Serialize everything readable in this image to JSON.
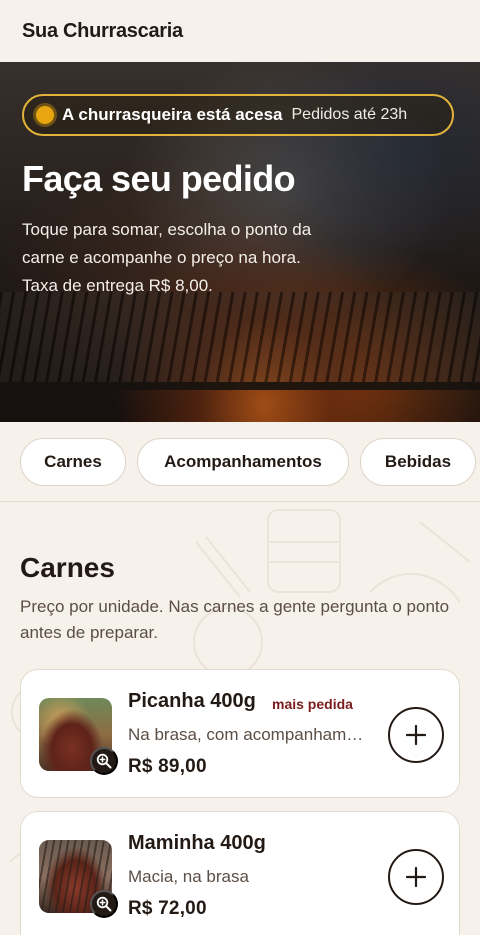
{
  "header": {
    "brand": "Sua Churrascaria"
  },
  "hero": {
    "status_main": "A churrasqueira está acesa",
    "status_sub": "Pedidos até 23h",
    "title": "Faça seu pedido",
    "description": "Toque para somar, escolha o ponto da carne e acompanhe o preço na hora. Taxa de entrega R$ 8,00."
  },
  "tabs": [
    {
      "label": "Carnes"
    },
    {
      "label": "Acompanhamentos"
    },
    {
      "label": "Bebidas"
    }
  ],
  "section": {
    "title": "Carnes",
    "description": "Preço por unidade. Nas carnes a gente pergunta o ponto antes de preparar."
  },
  "items": [
    {
      "name": "Picanha 400g",
      "badge": "mais pedida",
      "description": "Na brasa, com acompanhamentos",
      "price": "R$ 89,00",
      "icon": "zoom-in-icon",
      "add_icon": "plus-icon"
    },
    {
      "name": "Maminha 400g",
      "description": "Macia, na brasa",
      "price": "R$ 72,00",
      "icon": "zoom-in-icon",
      "add_icon": "plus-icon"
    }
  ],
  "colors": {
    "accent": "#e1b33a",
    "badge": "#7a1c1c",
    "text": "#231a16",
    "background": "#f6f1eb"
  }
}
